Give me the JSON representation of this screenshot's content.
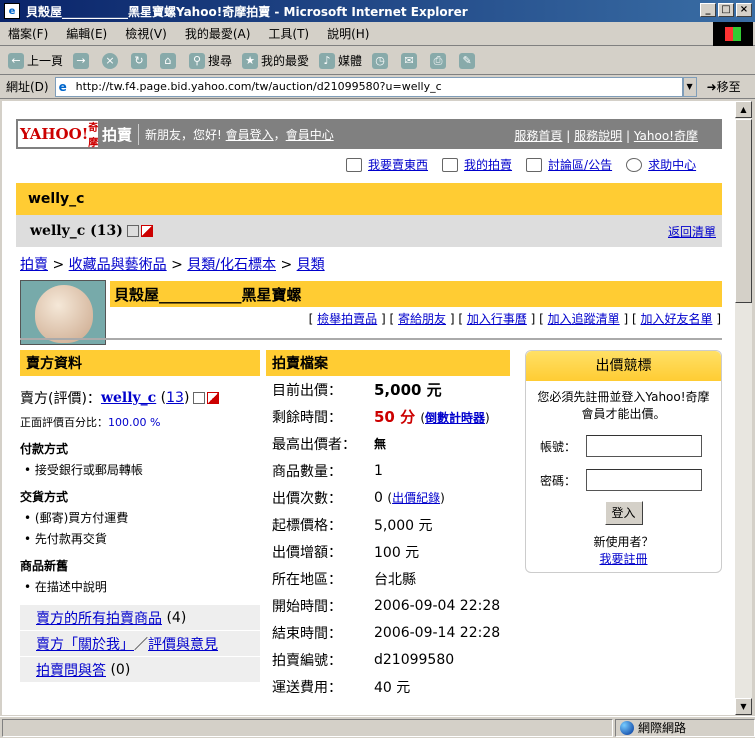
{
  "window": {
    "title": "貝殼屋___________黑星寶螺Yahoo!奇摩拍賣 - Microsoft Internet Explorer",
    "menu": [
      "檔案(F)",
      "編輯(E)",
      "檢視(V)",
      "我的最愛(A)",
      "工具(T)",
      "說明(H)"
    ],
    "toolbar": {
      "back": "上一頁",
      "search": "搜尋",
      "favorites": "我的最愛",
      "media": "媒體"
    },
    "address_label": "網址(D)",
    "url": "http://tw.f4.page.bid.yahoo.com/tw/auction/d21099580?u=welly_c",
    "go": "移至",
    "status_zone": "網際網路"
  },
  "header": {
    "logo": "YAHOO!",
    "logo_sub": "奇摩",
    "site_name": "拍賣",
    "hello": "新朋友，您好!",
    "login": "會員登入",
    "sep": "，",
    "member_center": "會員中心",
    "right": [
      "服務首頁",
      "服務說明",
      "Yahoo!奇摩"
    ],
    "right_sep": "|"
  },
  "top_links": [
    "我要賣東西",
    "我的拍賣",
    "討論區/公告",
    "求助中心"
  ],
  "seller_bar": {
    "name": "welly_c",
    "name_score": "welly_c (13)",
    "back": "返回清單"
  },
  "breadcrumb": [
    "拍賣",
    "收藏品與藝術品",
    "貝類/化石標本",
    "貝類"
  ],
  "breadcrumb_sep": ">",
  "item": {
    "title": "貝殼屋___________黑星寶螺",
    "links": [
      "檢舉拍賣品",
      "寄給朋友",
      "加入行事曆",
      "加入追蹤清單",
      "加入好友名單"
    ]
  },
  "seller_info": {
    "heading": "賣方資料",
    "seller_label": "賣方(評價)：",
    "seller_name": "welly_c",
    "score_open": "(",
    "score": "13",
    "score_close": ")",
    "pct_label": "正面評價百分比：",
    "pct_value": "100.00 %",
    "payment_heading": "付款方式",
    "payment": [
      "接受銀行或郵局轉帳"
    ],
    "shipping_heading": "交貨方式",
    "shipping": [
      "(郵寄)買方付運費",
      "先付款再交貨"
    ],
    "condition_heading": "商品新舊",
    "condition": [
      "在描述中說明"
    ],
    "links": {
      "all_items": "賣方的所有拍賣商品",
      "all_items_count": "(4)",
      "about": "賣方「關於我」",
      "slash": "／",
      "feedback": "評價與意見",
      "qa": "拍賣問與答",
      "qa_count": "(0)"
    }
  },
  "auction": {
    "heading": "拍賣檔案",
    "rows": [
      {
        "k": "目前出價：",
        "v": "5,000 元"
      },
      {
        "k": "剩餘時間：",
        "v": "50 分",
        "link": "倒數計時器"
      },
      {
        "k": "最高出價者：",
        "v": "無"
      },
      {
        "k": "商品數量：",
        "v": "1"
      },
      {
        "k": "出價次數：",
        "v": "0",
        "link": "出價紀錄"
      },
      {
        "k": "起標價格：",
        "v": "5,000 元"
      },
      {
        "k": "出價增額：",
        "v": "100 元"
      },
      {
        "k": "所在地區：",
        "v": "台北縣"
      },
      {
        "k": "開始時間：",
        "v": "2006-09-04 22:28"
      },
      {
        "k": "結束時間：",
        "v": "2006-09-14 22:28"
      },
      {
        "k": "拍賣編號：",
        "v": "d21099580"
      },
      {
        "k": "運送費用：",
        "v": "40 元"
      }
    ]
  },
  "bid_box": {
    "title": "出價競標",
    "message_1": "您必須先註冊並登入Yahoo!奇摩",
    "message_2": "會員才能出價。",
    "account_label": "帳號：",
    "password_label": "密碼：",
    "login_button": "登入",
    "new_user": "新使用者？",
    "register": "我要註冊"
  }
}
